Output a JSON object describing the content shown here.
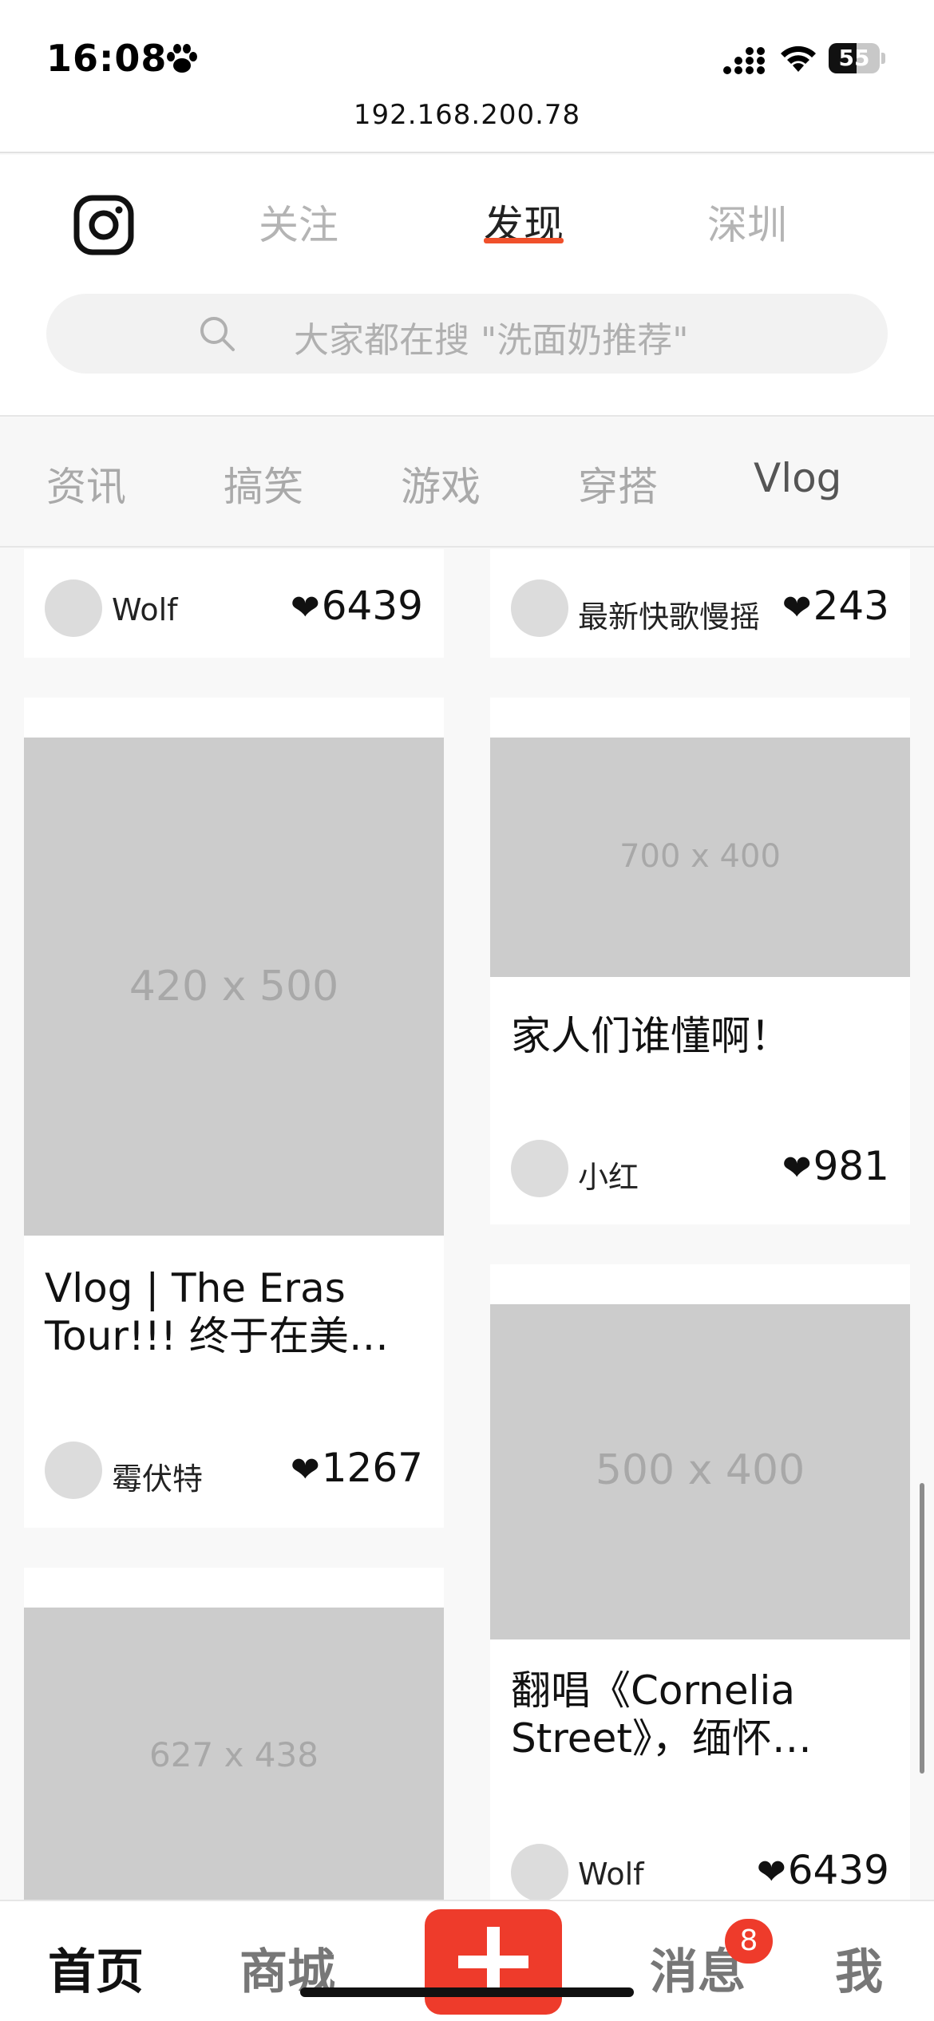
{
  "status_bar": {
    "time": "16:08",
    "battery": "55",
    "battery_level": 0.55
  },
  "browser": {
    "url": "192.168.200.78"
  },
  "header": {
    "tabs": [
      {
        "label": "关注"
      },
      {
        "label": "发现"
      },
      {
        "label": "深圳"
      }
    ],
    "active_tab": "发现",
    "search_placeholder": "大家都在搜 \"洗面奶推荐\""
  },
  "categories": [
    "资讯",
    "搞笑",
    "游戏",
    "穿搭",
    "Vlog"
  ],
  "feed": {
    "left": [
      {
        "author": "Wolf",
        "likes": "6439"
      },
      {
        "image": "420 x 500",
        "title": "Vlog | The Eras Tour!!! 终于在美…",
        "author": "霉伏特",
        "likes": "1267"
      },
      {
        "image": "627 x 438"
      }
    ],
    "right": [
      {
        "author": "最新快歌慢摇",
        "likes": "243"
      },
      {
        "image": "700 x 400",
        "title": "家人们谁懂啊！",
        "author": "小红",
        "likes": "981"
      },
      {
        "image": "500 x 400",
        "title": "翻唱《Cornelia Street》，缅怀…",
        "author": "Wolf",
        "likes": "6439"
      }
    ],
    "heart": "❤"
  },
  "bottom_nav": {
    "items": [
      "首页",
      "商城",
      "消息",
      "我"
    ],
    "active": "首页",
    "message_badge": "8"
  },
  "colors": {
    "accent": "#ee3b2b",
    "underline": "#f0502b",
    "placeholder_gray": "#cccccc"
  }
}
